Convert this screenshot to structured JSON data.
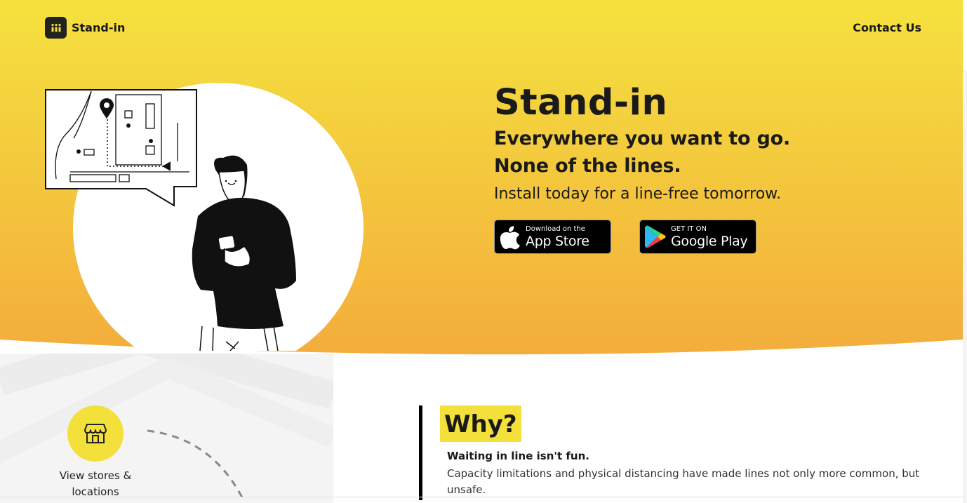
{
  "brand": {
    "name": "Stand-in",
    "accent": "#f4e03a",
    "gradient_top": "#f5e23e",
    "gradient_bottom": "#f3ad3c"
  },
  "nav": {
    "logo_icon": "app-logo-icon",
    "contact_label": "Contact Us"
  },
  "hero": {
    "title": "Stand-in",
    "subtitle_line1": "Everywhere you want to go.",
    "subtitle_line2": "None of the lines.",
    "install_text": "Install today for a line-free tomorrow."
  },
  "badges": {
    "app_store": {
      "small": "Download on the",
      "big": "App Store",
      "icon": "apple-icon"
    },
    "google_play": {
      "small": "GET IT ON",
      "big": "Google Play",
      "icon": "google-play-icon"
    }
  },
  "features": {
    "store_icon": "store-icon",
    "store_label": "View stores & locations"
  },
  "why": {
    "heading": "Why?",
    "subheading": "Waiting in line isn't fun.",
    "body": "Capacity limitations and physical distancing have made lines not only more common, but unsafe."
  }
}
